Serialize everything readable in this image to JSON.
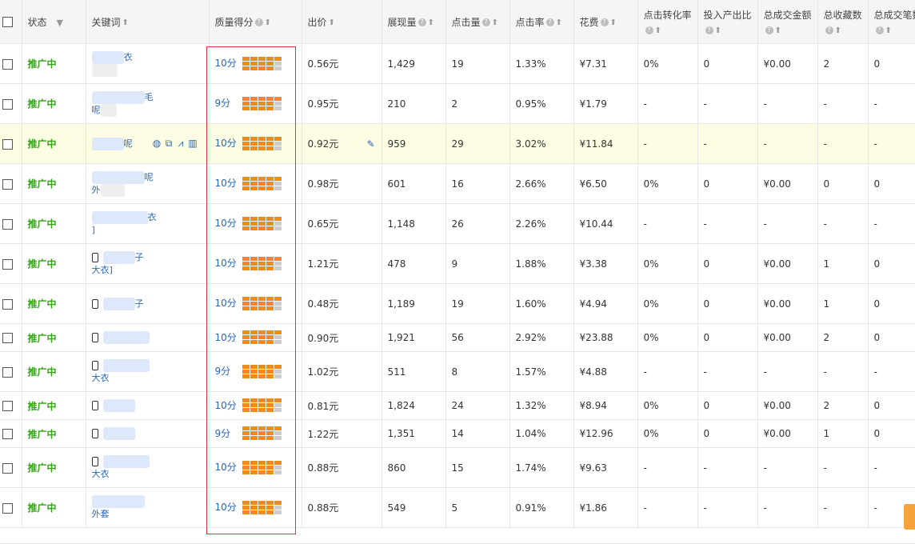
{
  "header": {
    "status": "状态",
    "keyword": "关键词",
    "quality": "质量得分",
    "bid": "出价",
    "impressions": "展现量",
    "clicks": "点击量",
    "ctr": "点击率",
    "cost": "花费",
    "cvr": "点击转化率",
    "roi": "投入产出比",
    "gmv": "总成交金额",
    "favorites": "总收藏数",
    "orders": "总成交笔数"
  },
  "icons": {
    "sort": "sort-up-icon",
    "dropdown": "triangle-down-icon",
    "help": "question-circle-icon",
    "phone": "mobile-phone-icon",
    "edit": "pencil-icon"
  },
  "colors": {
    "status_green": "#36a31a",
    "link_blue": "#2a67b5",
    "quality_orange": "#f08a1d",
    "highlight_row": "#fdfde4",
    "red_outline": "#d9363e"
  },
  "rows": [
    {
      "status": "推广中",
      "kw1": "衣",
      "kw2": "",
      "quality": "10分",
      "score": 10,
      "bid": "0.56元",
      "impressions": "1,429",
      "clicks": "19",
      "ctr": "1.33%",
      "cost": "¥7.31",
      "cvr": "0%",
      "roi": "0",
      "gmv": "¥0.00",
      "favorites": "2",
      "orders": "0"
    },
    {
      "status": "推广中",
      "kw1": "毛",
      "kw2": "呢",
      "quality": "9分",
      "score": 9,
      "bid": "0.95元",
      "impressions": "210",
      "clicks": "2",
      "ctr": "0.95%",
      "cost": "¥1.79",
      "cvr": "-",
      "roi": "-",
      "gmv": "-",
      "favorites": "-",
      "orders": "-"
    },
    {
      "status": "推广中",
      "kw1": "呢",
      "kw2": "",
      "quality": "10分",
      "score": 10,
      "bid": "0.92元",
      "impressions": "959",
      "clicks": "29",
      "ctr": "3.02%",
      "cost": "¥11.84",
      "cvr": "-",
      "roi": "-",
      "gmv": "-",
      "favorites": "-",
      "orders": "-"
    },
    {
      "status": "推广中",
      "kw1": "呢",
      "kw2": "外",
      "quality": "10分",
      "score": 10,
      "bid": "0.98元",
      "impressions": "601",
      "clicks": "16",
      "ctr": "2.66%",
      "cost": "¥6.50",
      "cvr": "0%",
      "roi": "0",
      "gmv": "¥0.00",
      "favorites": "0",
      "orders": "0"
    },
    {
      "status": "推广中",
      "kw1": "衣",
      "kw2": "]",
      "quality": "10分",
      "score": 10,
      "bid": "0.65元",
      "impressions": "1,148",
      "clicks": "26",
      "ctr": "2.26%",
      "cost": "¥10.44",
      "cvr": "-",
      "roi": "-",
      "gmv": "-",
      "favorites": "-",
      "orders": "-"
    },
    {
      "status": "推广中",
      "kw1": "子",
      "kw2": "大衣]",
      "quality": "10分",
      "score": 10,
      "bid": "1.21元",
      "impressions": "478",
      "clicks": "9",
      "ctr": "1.88%",
      "cost": "¥3.38",
      "cvr": "0%",
      "roi": "0",
      "gmv": "¥0.00",
      "favorites": "1",
      "orders": "0"
    },
    {
      "status": "推广中",
      "kw1": "子",
      "kw2": "",
      "quality": "10分",
      "score": 10,
      "bid": "0.48元",
      "impressions": "1,189",
      "clicks": "19",
      "ctr": "1.60%",
      "cost": "¥4.94",
      "cvr": "0%",
      "roi": "0",
      "gmv": "¥0.00",
      "favorites": "1",
      "orders": "0"
    },
    {
      "status": "推广中",
      "kw1": "",
      "kw2": "",
      "quality": "10分",
      "score": 10,
      "bid": "0.90元",
      "impressions": "1,921",
      "clicks": "56",
      "ctr": "2.92%",
      "cost": "¥23.88",
      "cvr": "0%",
      "roi": "0",
      "gmv": "¥0.00",
      "favorites": "2",
      "orders": "0"
    },
    {
      "status": "推广中",
      "kw1": "",
      "kw2": "大衣",
      "quality": "9分",
      "score": 9,
      "bid": "1.02元",
      "impressions": "511",
      "clicks": "8",
      "ctr": "1.57%",
      "cost": "¥4.88",
      "cvr": "-",
      "roi": "-",
      "gmv": "-",
      "favorites": "-",
      "orders": "-"
    },
    {
      "status": "推广中",
      "kw1": "",
      "kw2": "",
      "quality": "10分",
      "score": 10,
      "bid": "0.81元",
      "impressions": "1,824",
      "clicks": "24",
      "ctr": "1.32%",
      "cost": "¥8.94",
      "cvr": "0%",
      "roi": "0",
      "gmv": "¥0.00",
      "favorites": "2",
      "orders": "0"
    },
    {
      "status": "推广中",
      "kw1": "",
      "kw2": "",
      "quality": "9分",
      "score": 9,
      "bid": "1.22元",
      "impressions": "1,351",
      "clicks": "14",
      "ctr": "1.04%",
      "cost": "¥12.96",
      "cvr": "0%",
      "roi": "0",
      "gmv": "¥0.00",
      "favorites": "1",
      "orders": "0"
    },
    {
      "status": "推广中",
      "kw1": "",
      "kw2": "大衣",
      "quality": "10分",
      "score": 10,
      "bid": "0.88元",
      "impressions": "860",
      "clicks": "15",
      "ctr": "1.74%",
      "cost": "¥9.63",
      "cvr": "-",
      "roi": "-",
      "gmv": "-",
      "favorites": "-",
      "orders": "-"
    },
    {
      "status": "推广中",
      "kw1": "",
      "kw2": "外套",
      "quality": "10分",
      "score": 10,
      "bid": "0.88元",
      "impressions": "549",
      "clicks": "5",
      "ctr": "0.91%",
      "cost": "¥1.86",
      "cvr": "-",
      "roi": "-",
      "gmv": "-",
      "favorites": "-",
      "orders": "-"
    }
  ]
}
